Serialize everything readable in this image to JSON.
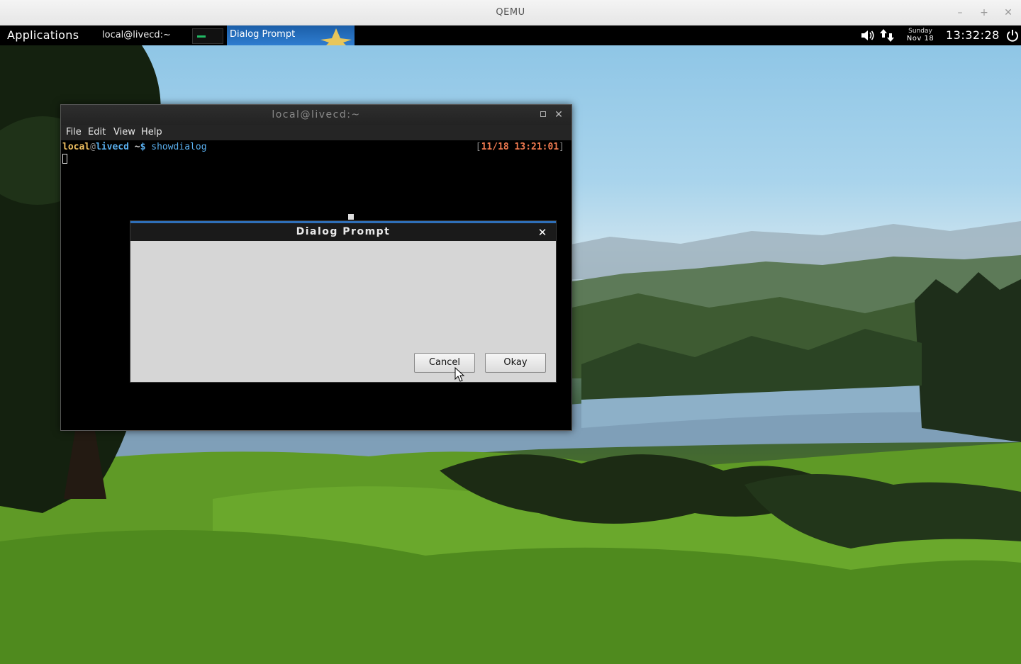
{
  "host": {
    "title": "QEMU",
    "controls": {
      "minimize": "–",
      "maximize": "+",
      "close": "✕"
    }
  },
  "panel": {
    "applications": "Applications",
    "tasks": [
      {
        "label": "local@livecd:~"
      },
      {
        "label": "Dialog Prompt",
        "active": true
      }
    ],
    "date": {
      "day": "Sunday",
      "month_day": "Nov 18"
    },
    "clock": "13:32:28",
    "icons": [
      "volume-icon",
      "network-icon",
      "power-icon"
    ]
  },
  "terminal": {
    "title": "local@livecd:~",
    "menu": [
      "File",
      "Edit",
      "View",
      "Help"
    ],
    "prompt": {
      "user": "local",
      "at": "@",
      "host": "livecd",
      "path": " ~",
      "dollar": "$",
      "command": " showdialog"
    },
    "timestamp": {
      "open": "[",
      "value": "11/18 13:21:01",
      "close": "]"
    },
    "controls": {
      "maximize": "",
      "close": "✕"
    }
  },
  "dialog": {
    "title": "Dialog Prompt",
    "close": "✕",
    "buttons": {
      "cancel": "Cancel",
      "okay": "Okay"
    }
  },
  "colors": {
    "panel_active": "#2f7dd0",
    "dialog_accent": "#2f6fb8",
    "prompt_user": "#f0c060",
    "prompt_host": "#5ab0f0",
    "timestamp": "#f07a50"
  }
}
